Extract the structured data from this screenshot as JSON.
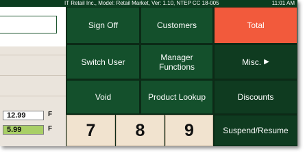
{
  "status_bar": {
    "info": "IT Retail Inc., Model: Retail Market, Ver: 1.10, NTEP CC 18-005",
    "clock": "11:01 AM"
  },
  "left_panel": {
    "lines": [
      {
        "amount": "12.99",
        "flag": "F"
      },
      {
        "amount": "5.99",
        "flag": "F"
      }
    ]
  },
  "buttons": {
    "sign_off": "Sign Off",
    "customers": "Customers",
    "total": "Total",
    "switch_user": "Switch User",
    "manager_functions": "Manager Functions",
    "misc": "Misc.",
    "misc_arrow": "▶",
    "void": "Void",
    "product_lookup": "Product Lookup",
    "discounts": "Discounts",
    "suspend_resume": "Suspend/Resume"
  },
  "keypad": {
    "k7": "7",
    "k8": "8",
    "k9": "9"
  },
  "colors": {
    "button_green": "#14502c",
    "total_red": "#f25a3c",
    "highlight_green": "#a9cf66",
    "keypad_cream": "#f1e3cf"
  }
}
